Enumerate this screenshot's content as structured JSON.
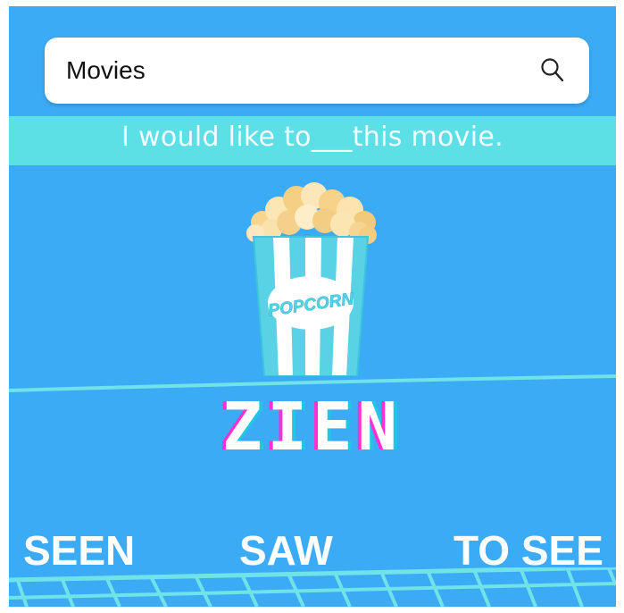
{
  "search": {
    "value": "Movies",
    "icon": "search-icon"
  },
  "prompt": {
    "text": "I would like to___this movie."
  },
  "illustration": {
    "icon": "popcorn-bucket-icon",
    "label": "POPCORN"
  },
  "brand": {
    "title": "ZIEN"
  },
  "choices": [
    {
      "label": "SEEN"
    },
    {
      "label": "SAW"
    },
    {
      "label": "TO SEE"
    }
  ],
  "colors": {
    "background": "#3cabf5",
    "prompt_strip": "#5ce0e6",
    "accent_cyan": "#5ce0e6",
    "title_shadow_magenta": "#ff2fd3",
    "title_shadow_cyan": "#21c6e6"
  }
}
